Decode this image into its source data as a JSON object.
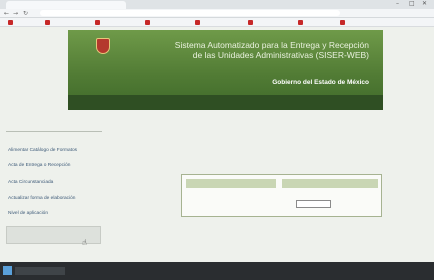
{
  "browser": {
    "tab_title": "",
    "url": "",
    "win_controls": [
      "–",
      "□",
      "✕"
    ],
    "bookmarks": [
      "",
      "",
      "",
      "",
      "",
      "",
      "",
      "",
      ""
    ]
  },
  "header": {
    "logo_text": "",
    "title_line1": "Sistema Automatizado para la Entrega y Recepción",
    "title_line2": "de las Unidades Administrativas (SISER-WEB)",
    "subtitle": "Gobierno del Estado de México",
    "menu": [
      "",
      "",
      "",
      ""
    ]
  },
  "sidebar": {
    "items": [
      "Alimentar Catálogo de Formatos",
      "Acta de Entrega o Recepción",
      "Acta Circunstanciada",
      "Actualizar forma de elaboración",
      "Nivel de aplicación"
    ],
    "box_text": ""
  },
  "main": {
    "section_title": "",
    "table": {
      "headers": [
        "",
        ""
      ],
      "row": [
        "",
        ""
      ]
    },
    "cerrar_label": ""
  },
  "taskbar": {
    "right_text": "",
    "left_text": ""
  },
  "colors": {
    "header_green": "#527c35",
    "menu_dark": "#2f4f23",
    "table_header": "#c9d6b4",
    "link_blue": "#3d5a78"
  },
  "icons": [
    "back-icon",
    "forward-icon",
    "reload-icon",
    "bookmark-icon",
    "cursor-icon",
    "windows-start-icon"
  ]
}
